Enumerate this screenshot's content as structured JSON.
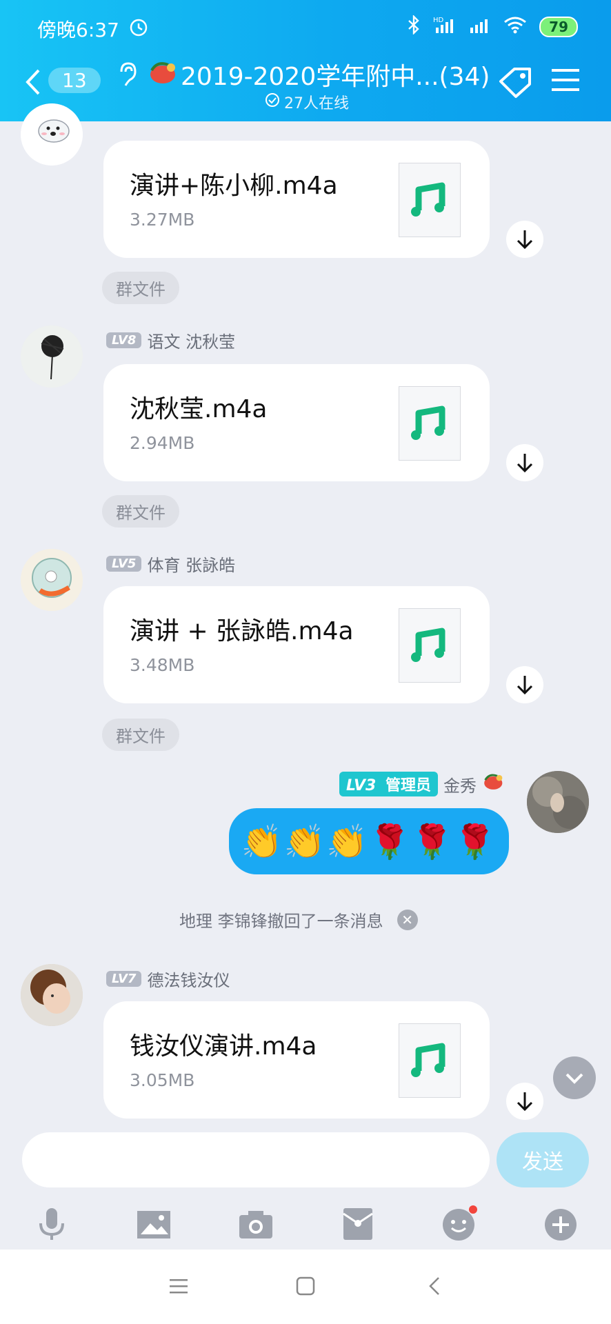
{
  "status_bar": {
    "time": "傍晚6:37",
    "battery": "79",
    "alarm_icon": "alarm-icon",
    "signal_icons": [
      "bluetooth-icon",
      "hd-signal-icon",
      "signal-icon",
      "wifi-icon"
    ]
  },
  "header": {
    "back_icon": "back-icon",
    "unread_count": "13",
    "ear_icon": "ear-icon",
    "title": "2019-2020学年附中...(34)",
    "online": "27人在线",
    "tag_icon": "tag-icon",
    "menu_icon": "menu-icon"
  },
  "messages": [
    {
      "file_name": "演讲+陈小柳.m4a",
      "file_size": "3.27MB",
      "chip": "群文件"
    },
    {
      "level": "LV8",
      "sender": "语文 沈秋莹",
      "file_name": "沈秋莹.m4a",
      "file_size": "2.94MB",
      "chip": "群文件"
    },
    {
      "level": "LV5",
      "sender": "体育 张詠皓",
      "file_name": "演讲 + 张詠皓.m4a",
      "file_size": "3.48MB",
      "chip": "群文件"
    },
    {
      "level": "LV3",
      "role": "管理员",
      "sender": "金秀",
      "text": "👏👏👏🌹🌹🌹"
    },
    {
      "recall_notice": "地理 李锦锋撤回了一条消息"
    },
    {
      "level": "LV7",
      "sender": "德法钱汝仪",
      "file_name": "钱汝仪演讲.m4a",
      "file_size": "3.05MB"
    }
  ],
  "input": {
    "placeholder": "",
    "send_label": "发送"
  },
  "toolbar": [
    "microphone-icon",
    "image-icon",
    "camera-icon",
    "red-packet-icon",
    "emoji-icon",
    "plus-icon"
  ],
  "colors": {
    "header": "#0ea9f0",
    "own_bubble": "#1aa9f3",
    "file_icon": "#14b87e",
    "background": "#eceef4",
    "admin_badge": "#1fc6cf"
  }
}
